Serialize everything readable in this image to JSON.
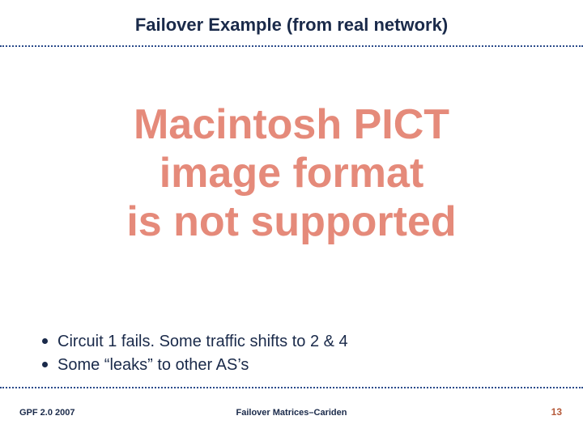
{
  "title": "Failover Example (from real network)",
  "error_message": {
    "line1": "Macintosh PICT",
    "line2": "image format",
    "line3": "is not supported"
  },
  "bullets": [
    "Circuit 1 fails. Some traffic shifts to 2 & 4",
    "Some “leaks” to other AS’s"
  ],
  "footer": {
    "left": "GPF 2.0 2007",
    "center": "Failover Matrices–Cariden",
    "page_number": "13"
  },
  "colors": {
    "title": "#1a2a4a",
    "error": "#e58a7a",
    "rule": "#2a4a8a",
    "page_number": "#b55a3a"
  }
}
